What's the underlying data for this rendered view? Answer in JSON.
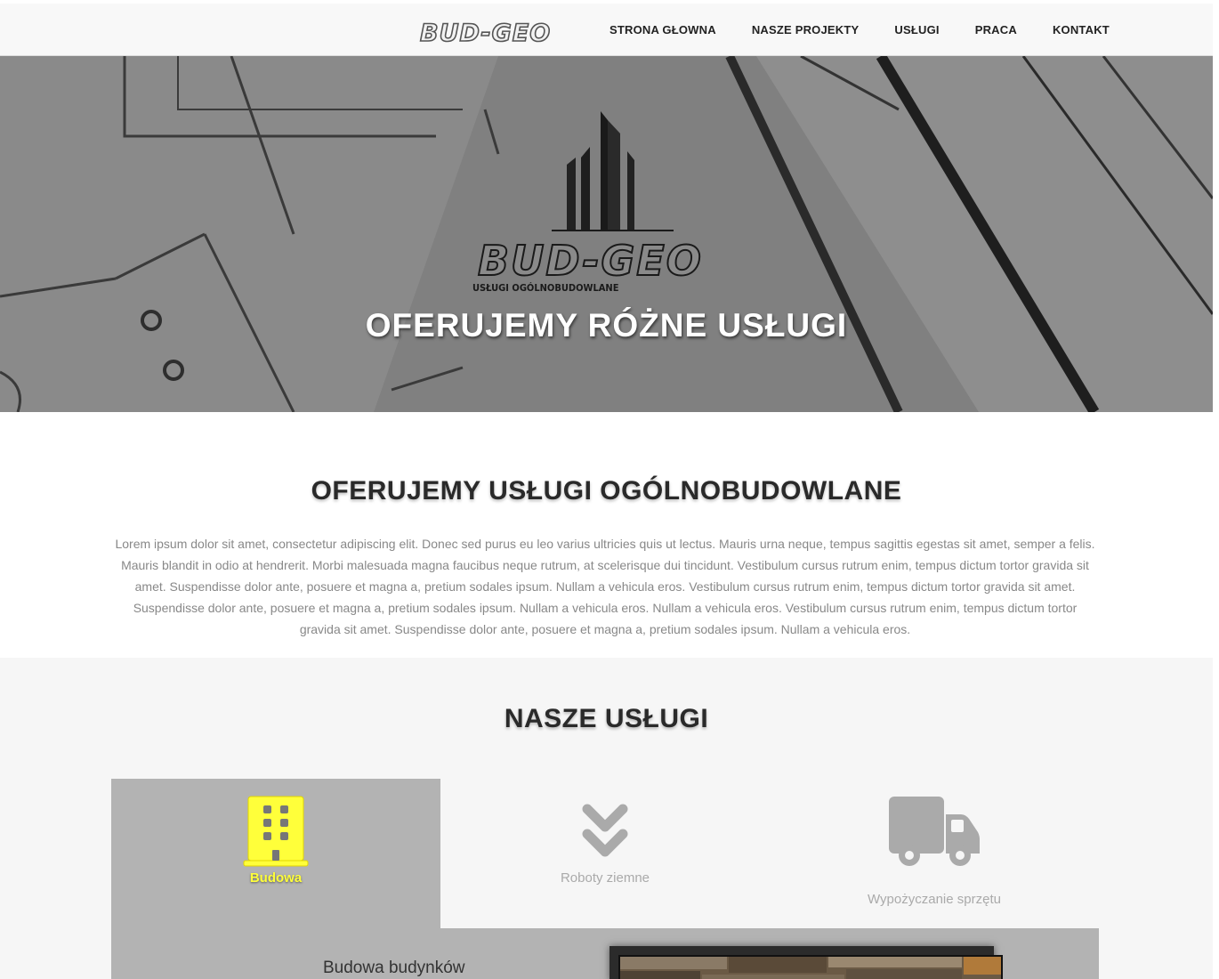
{
  "header": {
    "brand_text": "BUD-GEO",
    "nav": [
      {
        "label": "STRONA GŁOWNA"
      },
      {
        "label": "NASZE PROJEKTY"
      },
      {
        "label": "USŁUGI"
      },
      {
        "label": "PRACA"
      },
      {
        "label": "KONTAKT"
      }
    ]
  },
  "hero": {
    "logo_text": "BUD-GEO",
    "logo_tagline": "USŁUGI OGÓLNOBUDOWLANE",
    "title": "OFERUJEMY RÓŻNE USŁUGI"
  },
  "about": {
    "title": "OFERUJEMY USŁUGI OGÓLNOBUDOWLANE",
    "text": "Lorem ipsum dolor sit amet, consectetur adipiscing elit. Donec sed purus eu leo varius ultricies quis ut lectus. Mauris urna neque, tempus sagittis egestas sit amet, semper a felis. Mauris blandit in odio at hendrerit. Morbi malesuada magna faucibus neque rutrum, at scelerisque dui tincidunt. Vestibulum cursus rutrum enim, tempus dictum tortor gravida sit amet. Suspendisse dolor ante, posuere et magna a, pretium sodales ipsum. Nullam a vehicula eros. Vestibulum cursus rutrum enim, tempus dictum tortor gravida sit amet. Suspendisse dolor ante, posuere et magna a, pretium sodales ipsum. Nullam a vehicula eros. Nullam a vehicula eros. Vestibulum cursus rutrum enim, tempus dictum tortor gravida sit amet. Suspendisse dolor ante, posuere et magna a, pretium sodales ipsum. Nullam a vehicula eros."
  },
  "services": {
    "title": "NASZE USŁUGI",
    "tabs": [
      {
        "label": "Budowa",
        "icon": "building-icon",
        "active": true
      },
      {
        "label": "Roboty ziemne",
        "icon": "chevrons-down-icon",
        "active": false
      },
      {
        "label": "Wypożyczanie sprzętu",
        "icon": "truck-icon",
        "active": false
      }
    ],
    "panel": {
      "title": "Budowa budynków"
    }
  },
  "colors": {
    "accent_yellow": "#ffff3a",
    "active_tab_bg": "#b3b3b3",
    "section_bg": "#f6f6f6"
  }
}
